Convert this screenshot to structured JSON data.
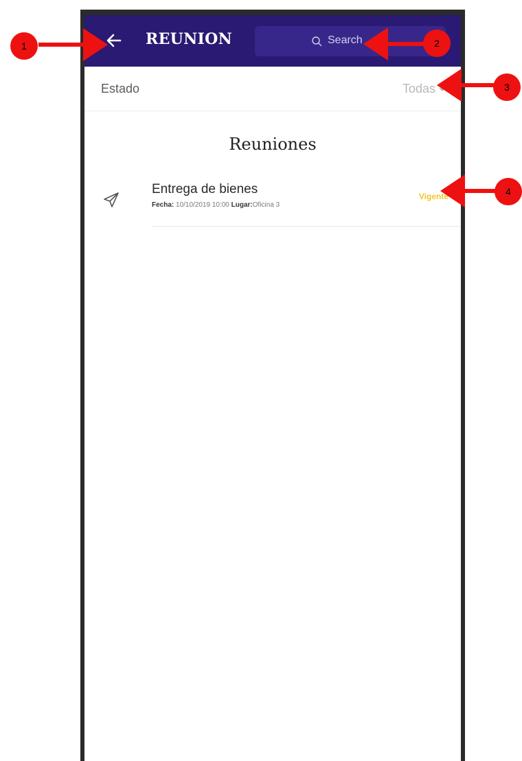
{
  "appbar": {
    "title": "REUNION",
    "back_icon": "arrow-left-icon",
    "search": {
      "placeholder": "Search",
      "icon": "search-icon"
    },
    "background_color": "#2a1a73"
  },
  "filter": {
    "label": "Estado",
    "selected": "Todas",
    "icon": "caret-down-icon"
  },
  "section": {
    "title": "Reuniones"
  },
  "meetings": [
    {
      "title": "Entrega de bienes",
      "icon": "paper-plane-icon",
      "fecha_label": "Fecha:",
      "fecha": "10/10/2019 10:00",
      "lugar_label": "Lugar:",
      "lugar": "Oficina 3",
      "status": "Vigente",
      "status_color": "#f3c62a"
    }
  ],
  "callouts": [
    {
      "number": "1"
    },
    {
      "number": "2"
    },
    {
      "number": "3"
    },
    {
      "number": "4"
    }
  ],
  "callout_color": "#ee1111"
}
